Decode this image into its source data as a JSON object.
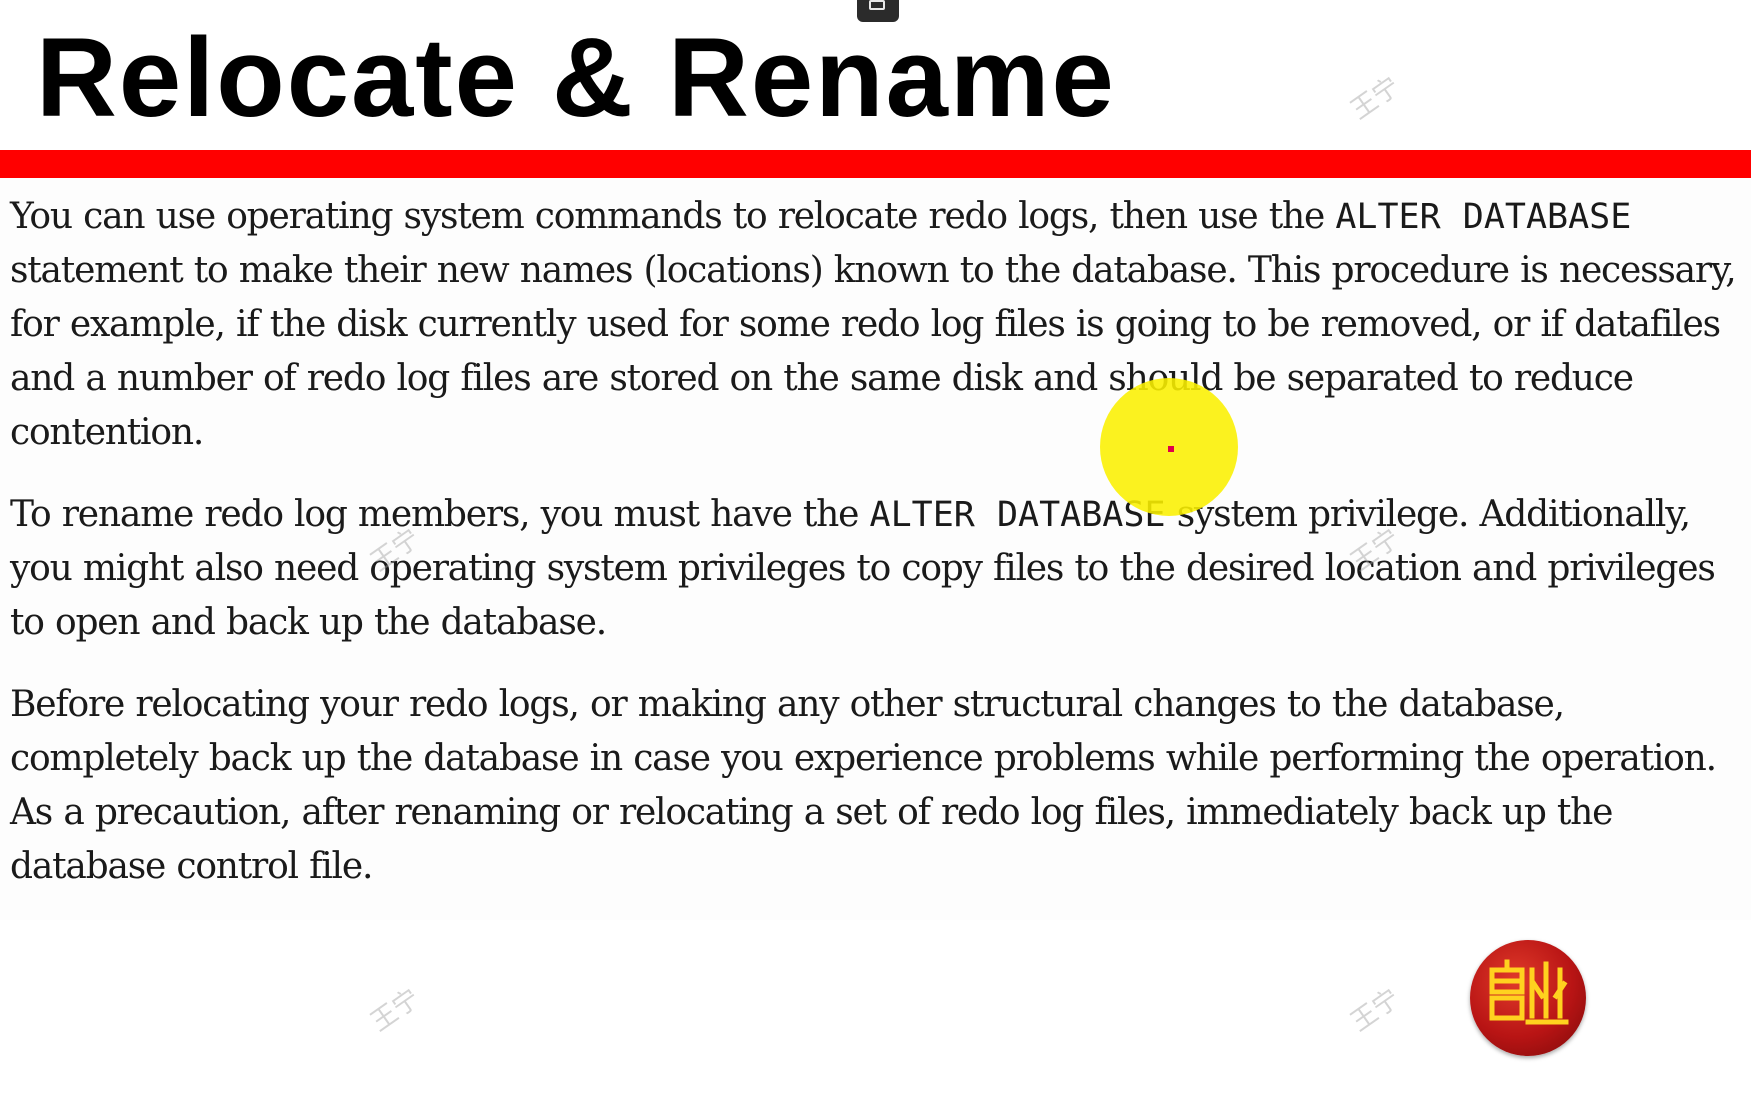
{
  "slide": {
    "title": "Relocate & Rename",
    "accent_color": "#ff0000",
    "paragraphs": {
      "p1": {
        "t1": "You can use operating system commands to relocate redo logs, then use the ",
        "c1": "ALTER DATABASE",
        "t2": " statement to make their new names (locations) known to the database. This procedure is necessary, for example, if the disk currently used for some redo log files is going to be removed, or if datafiles and a number of redo log files are stored on the same disk and should be separated to reduce contention."
      },
      "p2": {
        "t1": "To rename redo log members, you must have the ",
        "c1": "ALTER DATABASE",
        "t2": " system privilege. Additionally, you might also need operating system privileges to copy files to the desired location and privileges to open and back up the database."
      },
      "p3": {
        "t1": "Before relocating your redo logs, or making any other structural changes to the database, completely back up the database in case you experience problems while performing the operation. As a precaution, after renaming or relocating a set of redo log files, immediately back up the database control file."
      }
    }
  },
  "overlay": {
    "cursor_highlight_color": "#f5ee00",
    "watermark_text": "王宁",
    "logo_icon": "red-round-seal-logo"
  }
}
